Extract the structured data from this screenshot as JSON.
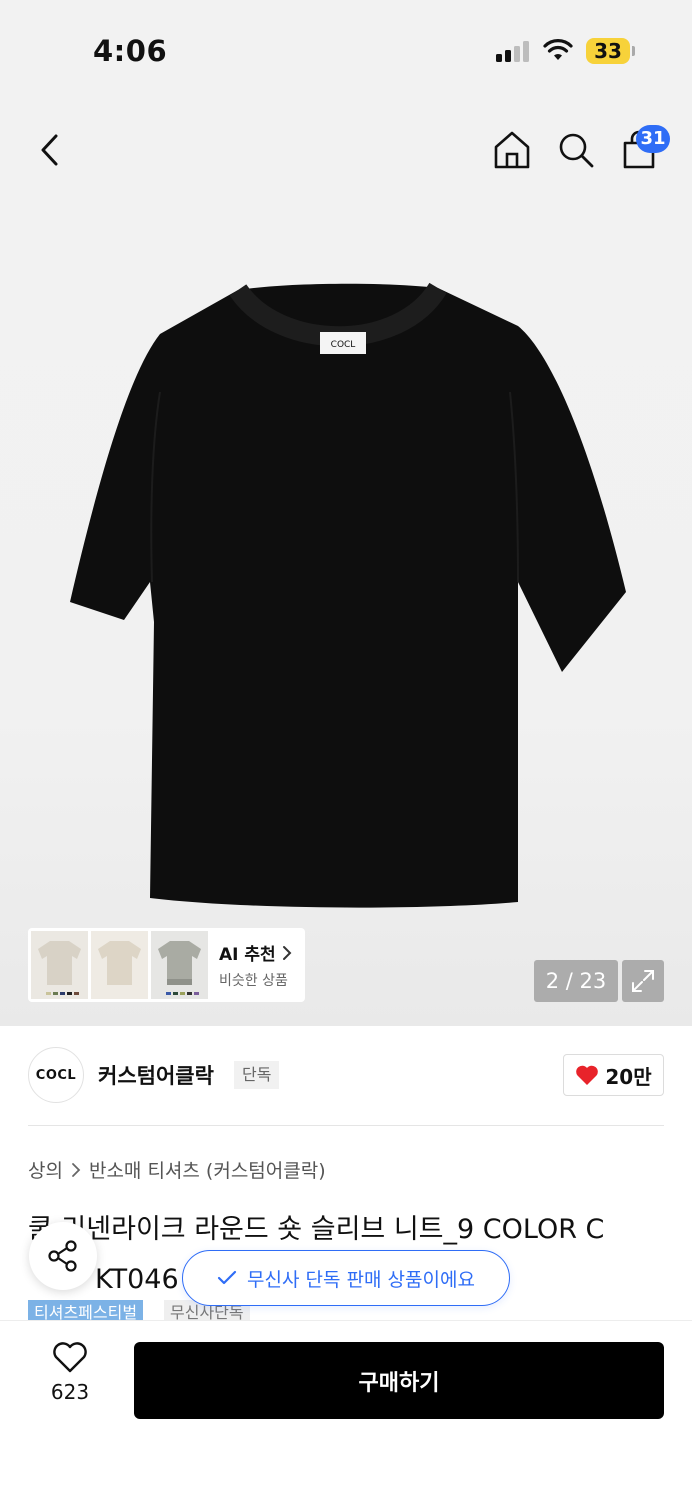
{
  "status_bar": {
    "time": "4:06",
    "battery": "33"
  },
  "header": {
    "cart_count": "31"
  },
  "product_image": {
    "logo_text": "COCL"
  },
  "ai_recommend": {
    "title": "AI 추천",
    "subtitle": "비슷한 상품"
  },
  "gallery": {
    "pager": "2 / 23"
  },
  "brand": {
    "logo": "COCL",
    "name": "커스텀어클락",
    "tag": "단독",
    "likes": "20만"
  },
  "breadcrumb": {
    "category": "상의",
    "subcategory": "반소매 티셔츠 (커스텀어클락)"
  },
  "product": {
    "title_line1": "쿨 리넨라이크 라운드 숏 슬리브 니트_9 COLOR C",
    "title_line2": "KT046"
  },
  "toast": {
    "text": "무신사 단독 판매 상품이에요"
  },
  "tags": [
    "티셔츠페스티벌",
    "무신사단독"
  ],
  "bottom": {
    "wish_count": "623",
    "buy_label": "구매하기"
  },
  "colors": {
    "accent": "#2f6df6",
    "heart": "#e8232a",
    "battery": "#f7d23a"
  }
}
